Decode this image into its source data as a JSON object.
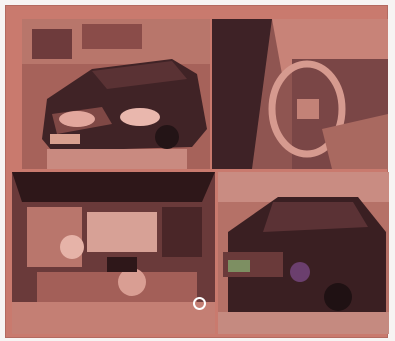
{
  "photos": [
    {
      "id": "front-view",
      "subject": "car-front"
    },
    {
      "id": "interior-view",
      "subject": "steering-wheel"
    },
    {
      "id": "engine-view",
      "subject": "engine-bay"
    },
    {
      "id": "rear-view",
      "subject": "car-rear"
    }
  ],
  "colors": {
    "tint": "#c97a6e",
    "shadow": "#3b1f22",
    "highlight": "#e9b7ad"
  }
}
